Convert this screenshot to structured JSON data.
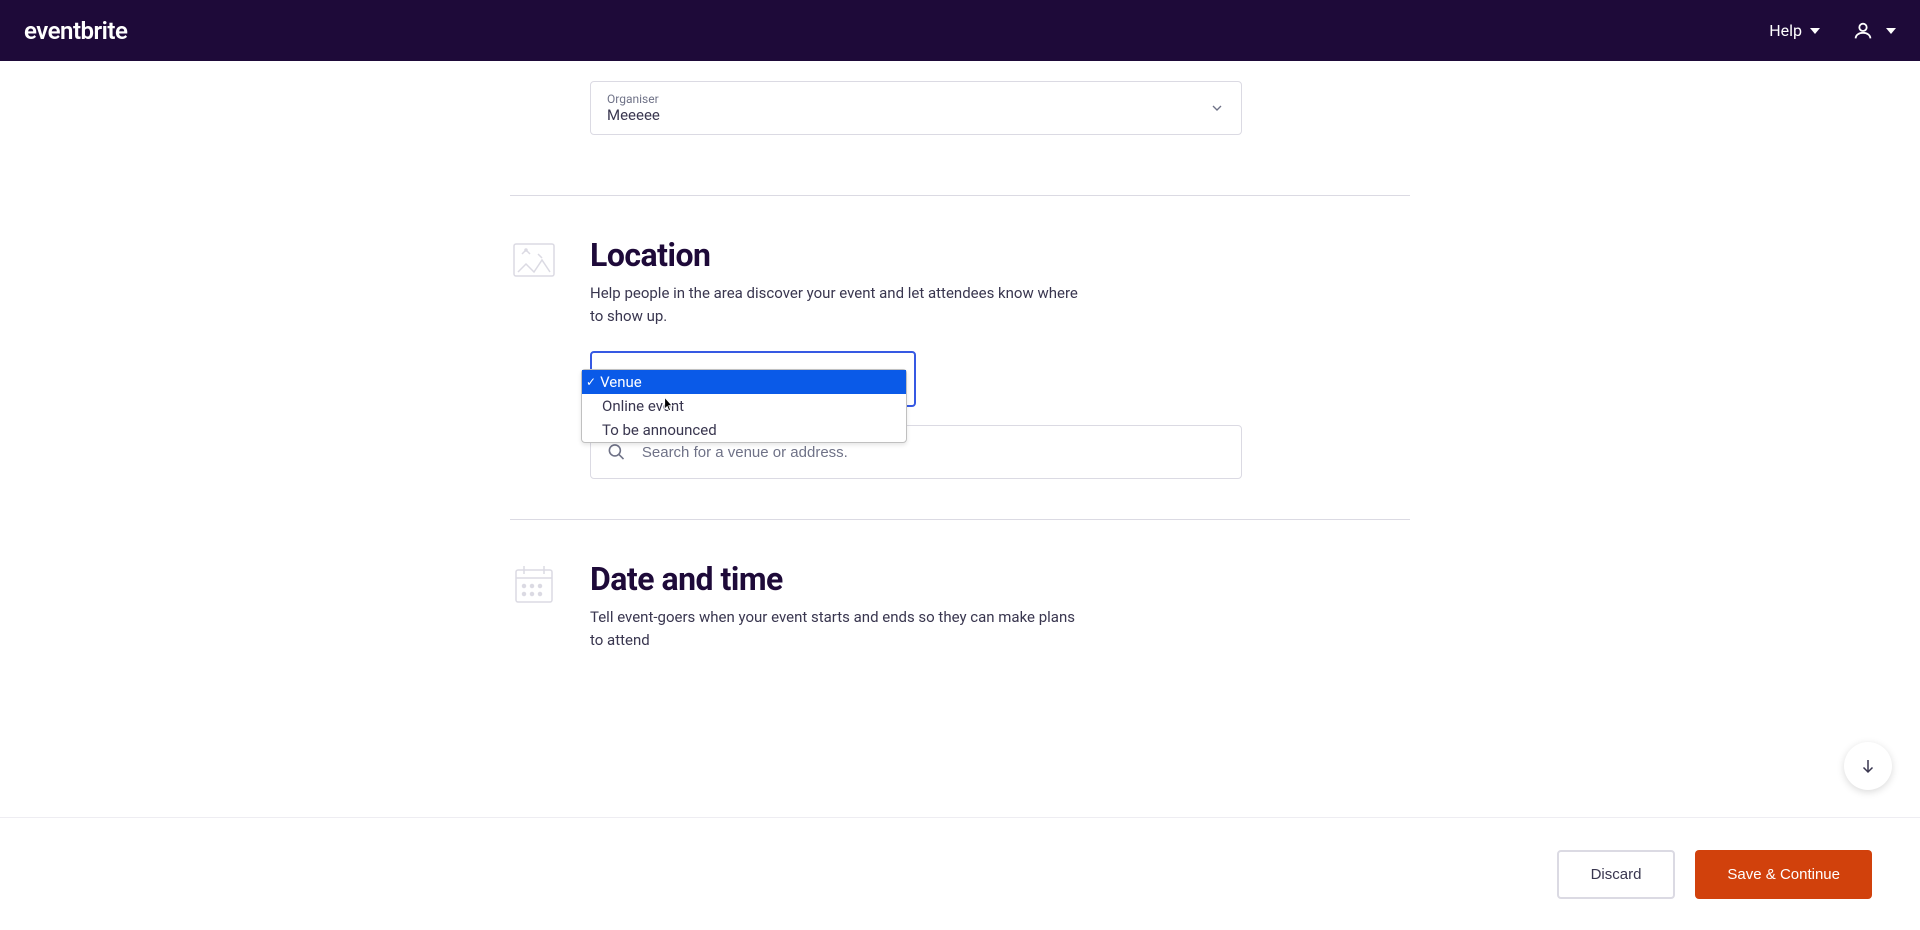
{
  "header": {
    "logo": "eventbrite",
    "help_label": "Help"
  },
  "organiser": {
    "label": "Organiser",
    "value": "Meeeee"
  },
  "location": {
    "title": "Location",
    "description": "Help people in the area discover your event and let attendees know where to show up.",
    "dropdown": {
      "options": [
        {
          "label": "Venue",
          "selected": true
        },
        {
          "label": "Online event",
          "selected": false
        },
        {
          "label": "To be announced",
          "selected": false
        }
      ]
    },
    "venue_search": {
      "placeholder": "Search for a venue or address."
    }
  },
  "datetime": {
    "title": "Date and time",
    "description": "Tell event-goers when your event starts and ends so they can make plans to attend"
  },
  "footer": {
    "discard_label": "Discard",
    "save_label": "Save & Continue"
  }
}
